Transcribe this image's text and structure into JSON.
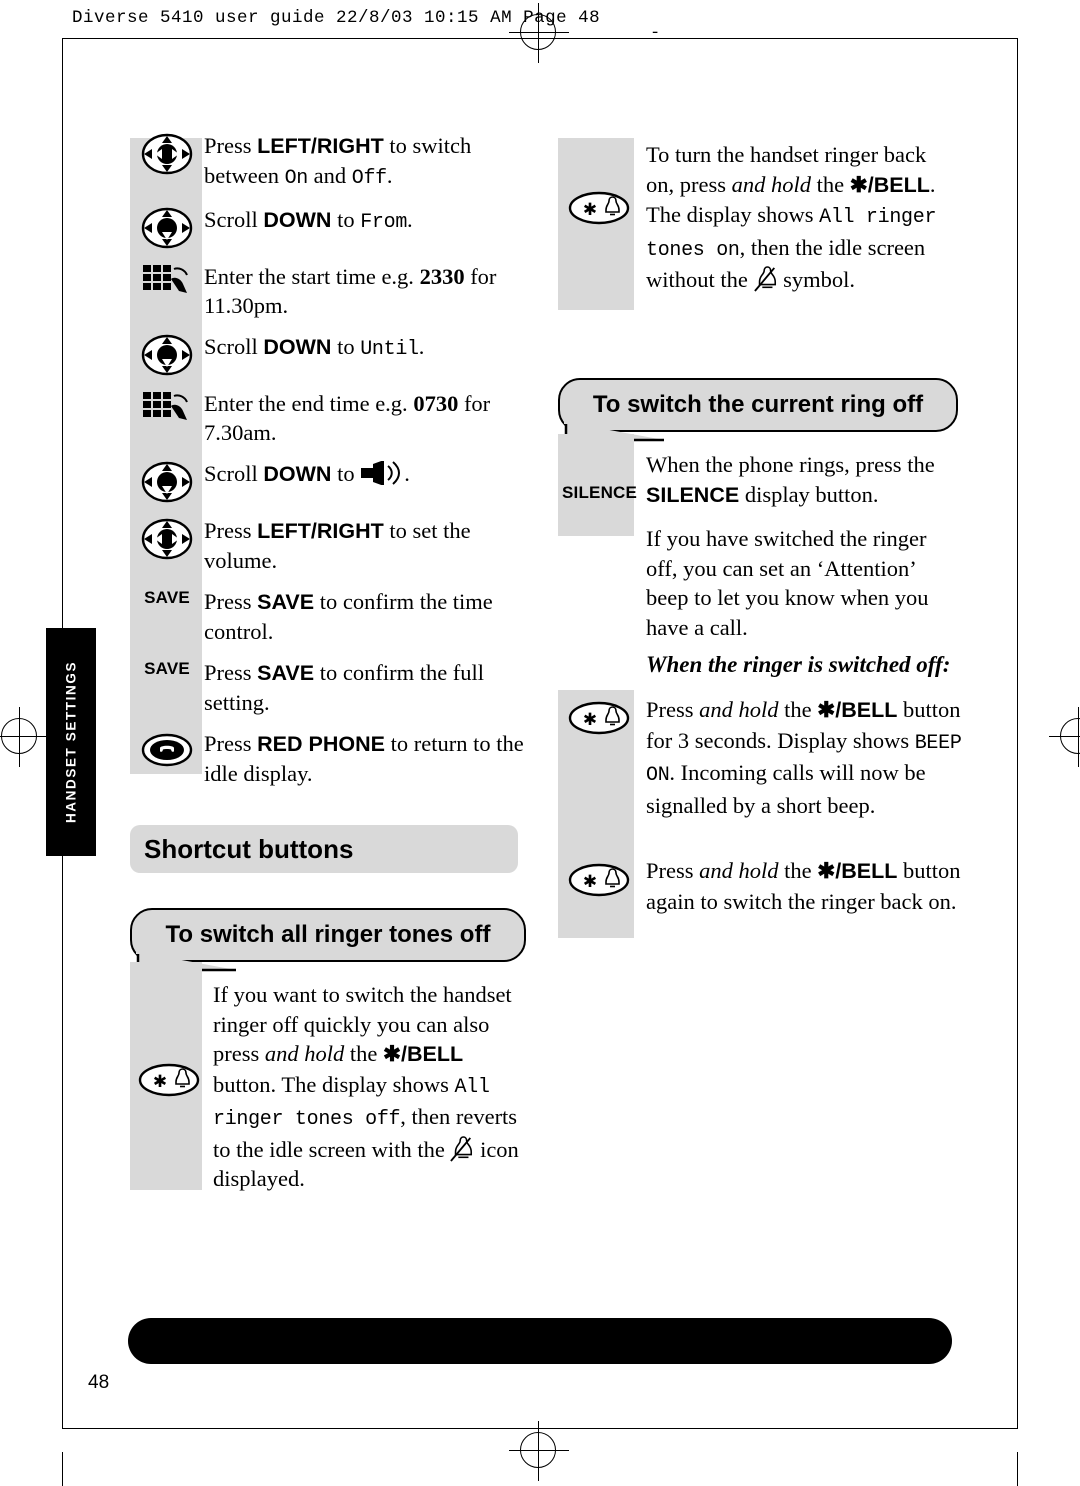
{
  "page": {
    "header": "Diverse 5410 user guide  22/8/03  10:15 AM  Page 48",
    "dash": "-",
    "page_number": "48",
    "side_tab": "HANDSET SETTINGS"
  },
  "left_column": {
    "steps": [
      {
        "icon": "navigation-key-left-right-icon",
        "icon_type": "nav",
        "html": "Press <span class=\"sans\">LEFT/RIGHT</span> to switch between <span class=\"lcd\">On</span> and <span class=\"lcd\">Off</span>."
      },
      {
        "icon": "navigation-key-down-icon",
        "icon_type": "nav",
        "html": "Scroll <span class=\"sans\">DOWN</span> to <span class=\"lcd\">From</span>."
      },
      {
        "icon": "keypad-icon",
        "icon_type": "keypad",
        "html": "Enter the start time e.g. <b>2330</b> for 11.30pm."
      },
      {
        "icon": "navigation-key-down-icon",
        "icon_type": "nav",
        "html": "Scroll <span class=\"sans\">DOWN</span> to <span class=\"lcd\">Until</span>."
      },
      {
        "icon": "keypad-icon",
        "icon_type": "keypad",
        "html": "Enter the end time e.g. <b>0730</b> for 7.30am."
      },
      {
        "icon": "navigation-key-down-icon",
        "icon_type": "nav",
        "html": "Scroll <span class=\"sans\">DOWN</span> to <span class=\"volume-inline\"></span>."
      },
      {
        "icon": "navigation-key-left-right-icon",
        "icon_type": "nav",
        "html": "Press <span class=\"sans\">LEFT/RIGHT</span> to set the volume."
      },
      {
        "icon": "save-button-icon",
        "icon_type": "label",
        "icon_label": "SAVE",
        "html": "Press <span class=\"sans\">SAVE</span> to confirm the time control."
      },
      {
        "icon": "save-button-icon",
        "icon_type": "label",
        "icon_label": "SAVE",
        "html": "Press <span class=\"sans\">SAVE</span> to confirm the full setting."
      },
      {
        "icon": "red-phone-key-icon",
        "icon_type": "redphone",
        "html": "Press <span class=\"sans\">RED PHONE</span> to return to the idle display."
      }
    ],
    "shortcut_heading": "Shortcut buttons",
    "ringer_off_callout": "To switch all ringer tones off",
    "ringer_off_body": "If you want to switch the handset ringer off quickly you can also press <span class=\"it\">and hold</span> the <span class=\"sans\">✱/BELL</span> button. The display shows <span class=\"lcd\">All ringer tones off</span>, then reverts to the idle screen with the <span class=\"bell-crossed-inline\"></span> icon displayed."
  },
  "right_column": {
    "turn_back_on_body": "To turn the handset ringer back on, press <span class=\"it\">and hold</span> the <span class=\"sans\">✱/BELL</span>. The display shows <span class=\"lcd\">All ringer tones on</span>, then the idle screen without the <span class=\"bell-crossed-inline\"></span> symbol.",
    "current_ring_callout": "To switch the current ring off",
    "silence_label": "SILENCE",
    "silence_body": "When the phone rings, press the <span class=\"sans\">SILENCE</span> display button.",
    "attention_body": "If you have switched the ringer off, you can set an ‘Attention’ beep to let you know when you have a call.",
    "sub_heading": "When the ringer is switched off:",
    "steps": [
      {
        "icon": "star-bell-key-icon",
        "html": "Press <span class=\"it\">and hold</span> the <span class=\"sans\">✱/BELL</span> button for 3 seconds. Display shows <span class=\"lcd\">BEEP ON</span>. Incoming calls will now be signalled by a short beep."
      },
      {
        "icon": "star-bell-key-icon",
        "html": "Press <span class=\"it\">and hold</span> the <span class=\"sans\">✱/BELL</span> button again to switch the ringer back on."
      }
    ]
  }
}
